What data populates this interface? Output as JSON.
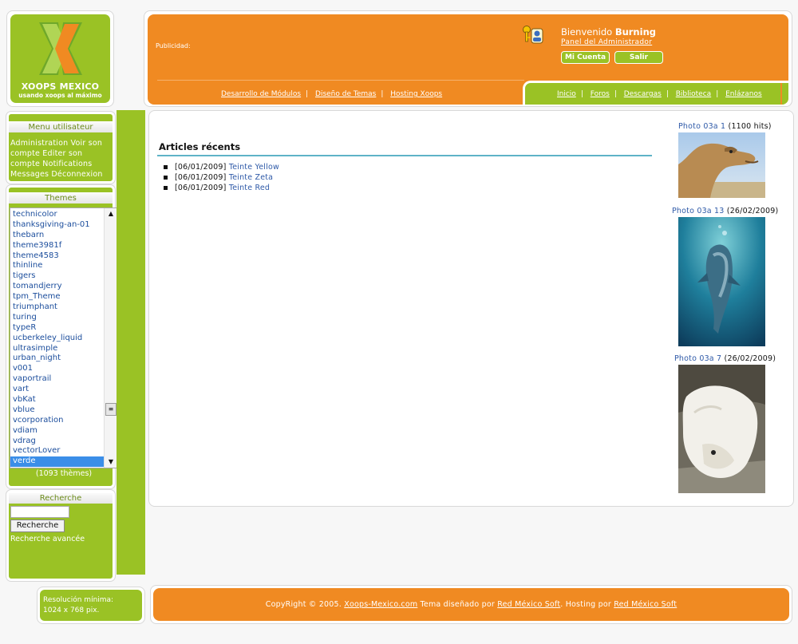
{
  "logo": {
    "title": "XOOPS MEXICO",
    "subtitle": "usando xoops al máximo"
  },
  "header": {
    "publicidad": "Publicidad:",
    "welcome_prefix": "Bienvenido",
    "username": "Burning",
    "admin_link": "Panel del Administrador",
    "my_account": "Mi Cuenta",
    "logout": "Salir",
    "nav_left": [
      "Desarrollo de Módulos",
      "Diseño de Temas",
      "Hosting Xoops"
    ],
    "nav_right": [
      "Inicio",
      "Foros",
      "Descargas",
      "Biblioteca",
      "Enlázanos"
    ]
  },
  "user_menu": {
    "title": "Menu utilisateur",
    "text": "Administration Voir son compte Editer son compte Notifications Messages Déconnexion"
  },
  "themes": {
    "title": "Themes",
    "items": [
      "technicolor",
      "thanksgiving-an-01",
      "thebarn",
      "theme3981f",
      "theme4583",
      "thinline",
      "tigers",
      "tomandjerry",
      "tpm_Theme",
      "triumphant",
      "turing",
      "typeR",
      "ucberkeley_liquid",
      "ultrasimple",
      "urban_night",
      "v001",
      "vaportrail",
      "vart",
      "vbKat",
      "vblue",
      "vcorporation",
      "vdiam",
      "vdrag",
      "vectorLover",
      "verde"
    ],
    "selected": "verde",
    "count": "(1093 thèmes)"
  },
  "search": {
    "title": "Recherche",
    "button": "Recherche",
    "advanced": "Recherche avancée"
  },
  "articles": {
    "title": "Articles récents",
    "items": [
      {
        "date": "[06/01/2009]",
        "title": "Teinte Yellow"
      },
      {
        "date": "[06/01/2009]",
        "title": "Teinte Zeta"
      },
      {
        "date": "[06/01/2009]",
        "title": "Teinte Red"
      }
    ]
  },
  "photos": [
    {
      "link": "Photo 03a 1",
      "info": "(1100 hits)",
      "subject": "camel-photo"
    },
    {
      "link": "Photo 03a 13",
      "info": "(26/02/2009)",
      "subject": "dolphin-photo"
    },
    {
      "link": "Photo 03a 7",
      "info": "(26/02/2009)",
      "subject": "polar-bear-photo"
    }
  ],
  "resolution": {
    "line1": "Resolución mínima:",
    "line2": "1024 x 768 pix."
  },
  "footer": {
    "prefix": "CopyRight © 2005.",
    "site": "Xoops-Mexico.com",
    "theme_text": "Tema diseñado por",
    "designer": "Red México Soft",
    "hosting_text": ". Hosting por",
    "host": "Red México Soft"
  },
  "colors": {
    "orange": "#f08a22",
    "green": "#9ac225",
    "link": "#2f5aa8",
    "rule": "#5fb3c7"
  }
}
